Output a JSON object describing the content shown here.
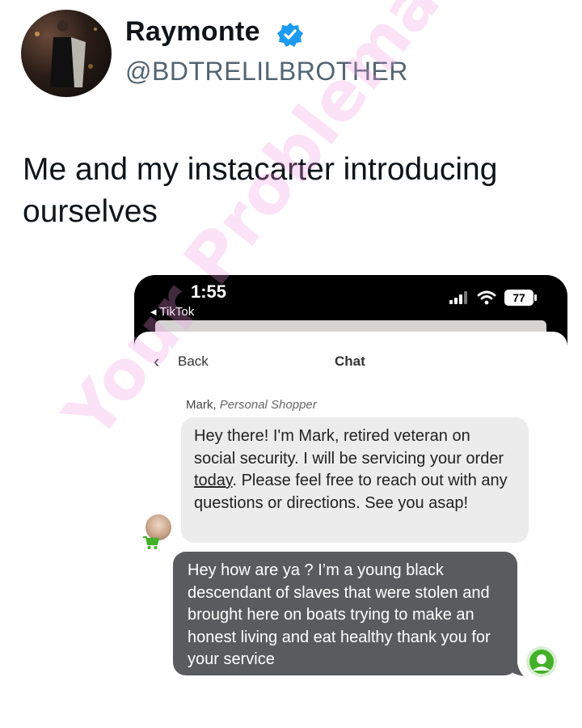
{
  "tweet": {
    "display_name": "Raymonte",
    "handle": "@BDTRELILBROTHER",
    "verified_icon": "verified-badge-icon",
    "text": "Me and my instacarter introducing ourselves"
  },
  "phone": {
    "status_time": "1:55",
    "back_app_label": "◂ TikTok",
    "battery_level": "77",
    "icons": [
      "signal-icon",
      "wifi-icon",
      "battery-icon"
    ]
  },
  "chat": {
    "back_icon": "‹",
    "back_label": "Back",
    "title": "Chat",
    "sender_name": "Mark",
    "sender_sep": ", ",
    "sender_role": "Personal Shopper",
    "shopper_message_before": "Hey there! I'm Mark, retired veteran on social security. I will be servicing your order ",
    "shopper_message_underlined": "today",
    "shopper_message_after": ". Please feel free to reach out with any questions or directions. See you asap!",
    "customer_message": "Hey how are ya ? I’m a young black descendant of slaves that were stolen and brought here on boats trying to make an honest living and eat healthy thank you for your service"
  },
  "watermark": "Your Problematic Faves",
  "colors": {
    "verified": "#1d9bf0",
    "incoming_bubble": "#ececec",
    "outgoing_bubble": "#5a5b5f",
    "watermark": "#f096e1",
    "instacart_green": "#43b02a"
  }
}
